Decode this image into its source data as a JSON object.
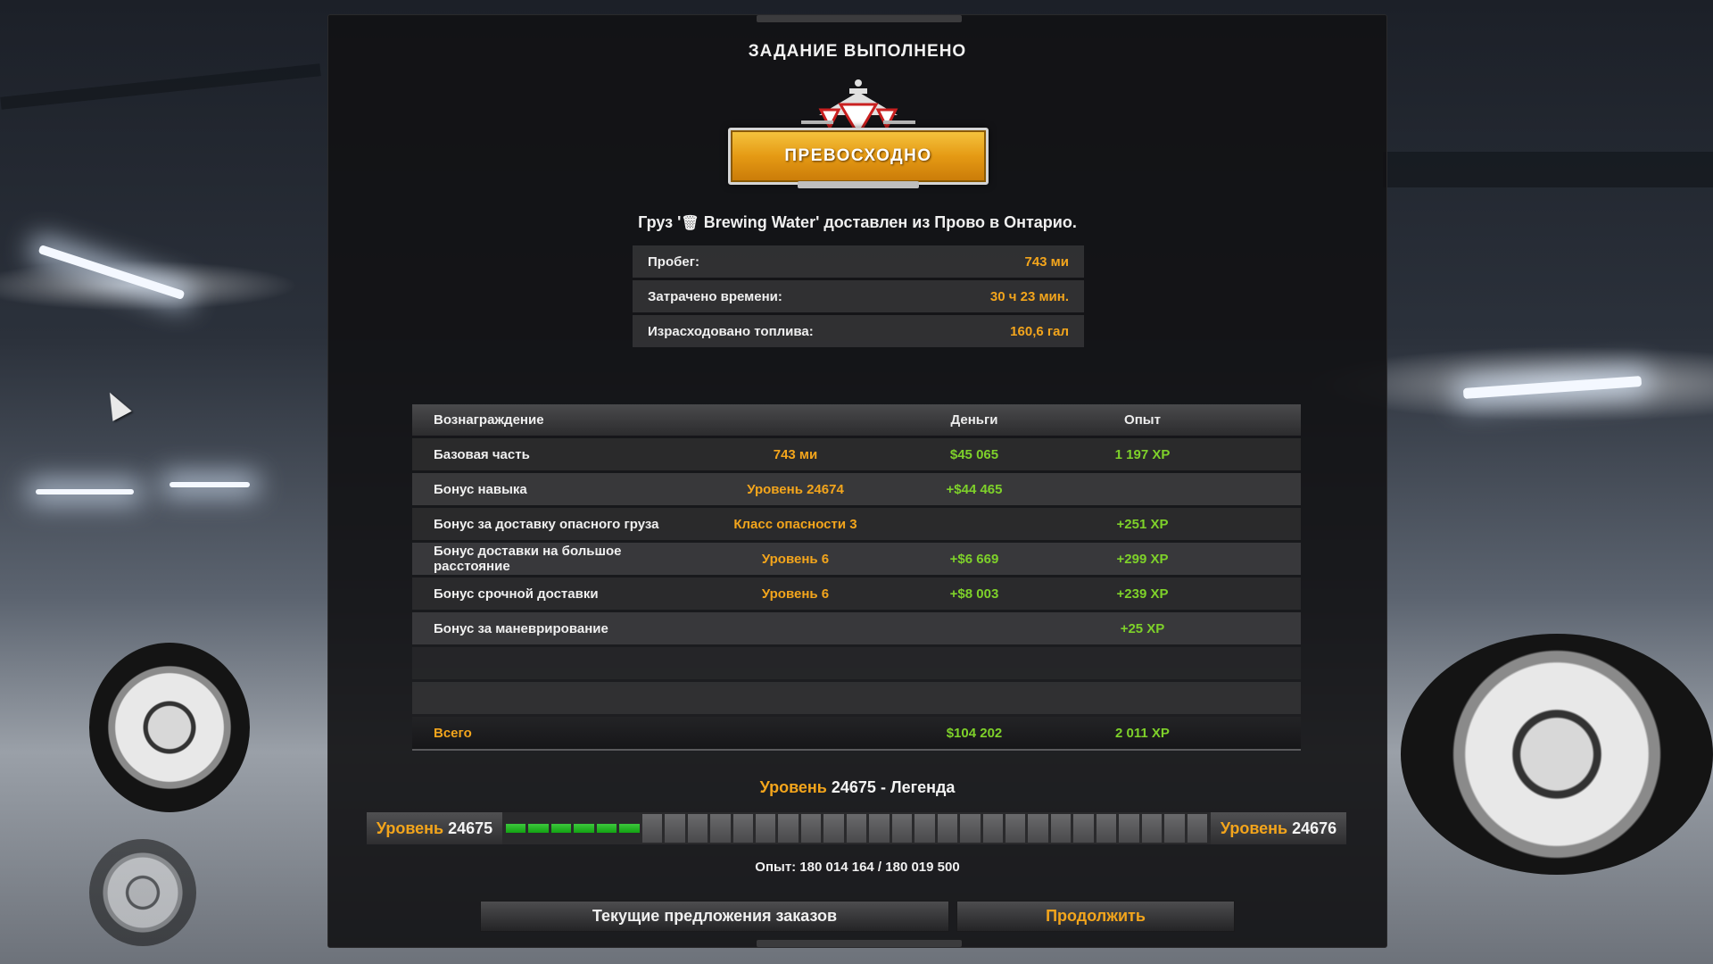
{
  "dialog": {
    "title": "ЗАДАНИЕ ВЫПОЛНЕНО",
    "badge_label": "ПРЕВОСХОДНО",
    "cargo_prefix": "Груз '",
    "cargo_icon": "🗑",
    "cargo_rest": " Brewing Water' доставлен из Прово в Онтарио."
  },
  "stats": [
    {
      "label": "Пробег:",
      "value": "743 ми"
    },
    {
      "label": "Затрачено времени:",
      "value": "30 ч 23 мин."
    },
    {
      "label": "Израсходовано топлива:",
      "value": "160,6 гал"
    }
  ],
  "rewards": {
    "headers": {
      "reward": "Вознаграждение",
      "money": "Деньги",
      "xp": "Опыт"
    },
    "rows": [
      {
        "name": "Базовая часть",
        "detail": "743 ми",
        "money": "$45 065",
        "xp": "1 197 XP"
      },
      {
        "name": "Бонус навыка",
        "detail": "Уровень 24674",
        "money": "+$44 465",
        "xp": ""
      },
      {
        "name": "Бонус за доставку опасного груза",
        "detail": "Класс опасности 3",
        "money": "",
        "xp": "+251 XP"
      },
      {
        "name": "Бонус доставки на большое расстояние",
        "detail": "Уровень 6",
        "money": "+$6 669",
        "xp": "+299 XP"
      },
      {
        "name": "Бонус срочной доставки",
        "detail": "Уровень 6",
        "money": "+$8 003",
        "xp": "+239 XP"
      },
      {
        "name": "Бонус за маневрирование",
        "detail": "",
        "money": "",
        "xp": "+25 XP"
      }
    ],
    "total": {
      "name": "Всего",
      "money": "$104 202",
      "xp": "2 011 XP"
    }
  },
  "level": {
    "word": "Уровень",
    "current": "24675",
    "title_suffix": " - Легенда",
    "next": "24676",
    "progress_fraction": 0.2,
    "segments": 31,
    "xp_text": "Опыт: 180 014 164 / 180 019 500"
  },
  "buttons": {
    "offers": "Текущие предложения заказов",
    "continue": "Продолжить"
  },
  "colors": {
    "accent_orange": "#f3a51c",
    "money_green": "#7ed12a",
    "progress_green": "#1fb31f"
  }
}
